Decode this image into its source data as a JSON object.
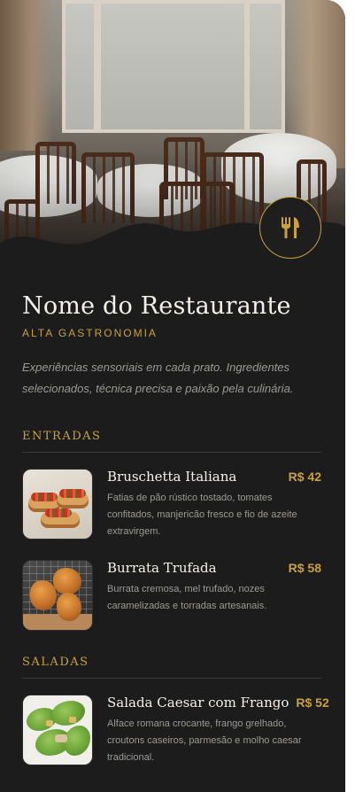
{
  "restaurant": {
    "name": "Nome do Restaurante",
    "tagline": "ALTA GASTRONOMIA",
    "intro": "Experiências sensoriais em cada prato. Ingredientes selecionados, técnica precisa e paixão pela culinária.",
    "badge_icon": "fork-knife-icon"
  },
  "colors": {
    "background": "#1c1c1c",
    "accent": "#c9a13b",
    "text_primary": "#f4f1ea",
    "text_muted": "#9c9a95"
  },
  "sections": [
    {
      "title": "ENTRADAS",
      "items": [
        {
          "name": "Bruschetta Italiana",
          "price": "R$ 42",
          "description": "Fatias de pão rústico tostado, tomates confitados, manjericão fresco e fio de azeite extravirgem."
        },
        {
          "name": "Burrata Trufada",
          "price": "R$ 58",
          "description": "Burrata cremosa, mel trufado, nozes caramelizadas e torradas artesanais."
        }
      ]
    },
    {
      "title": "SALADAS",
      "items": [
        {
          "name": "Salada Caesar com Frango",
          "price": "R$ 52",
          "description": "Alface romana crocante, frango grelhado, croutons caseiros, parmesão e molho caesar tradicional."
        }
      ]
    }
  ]
}
